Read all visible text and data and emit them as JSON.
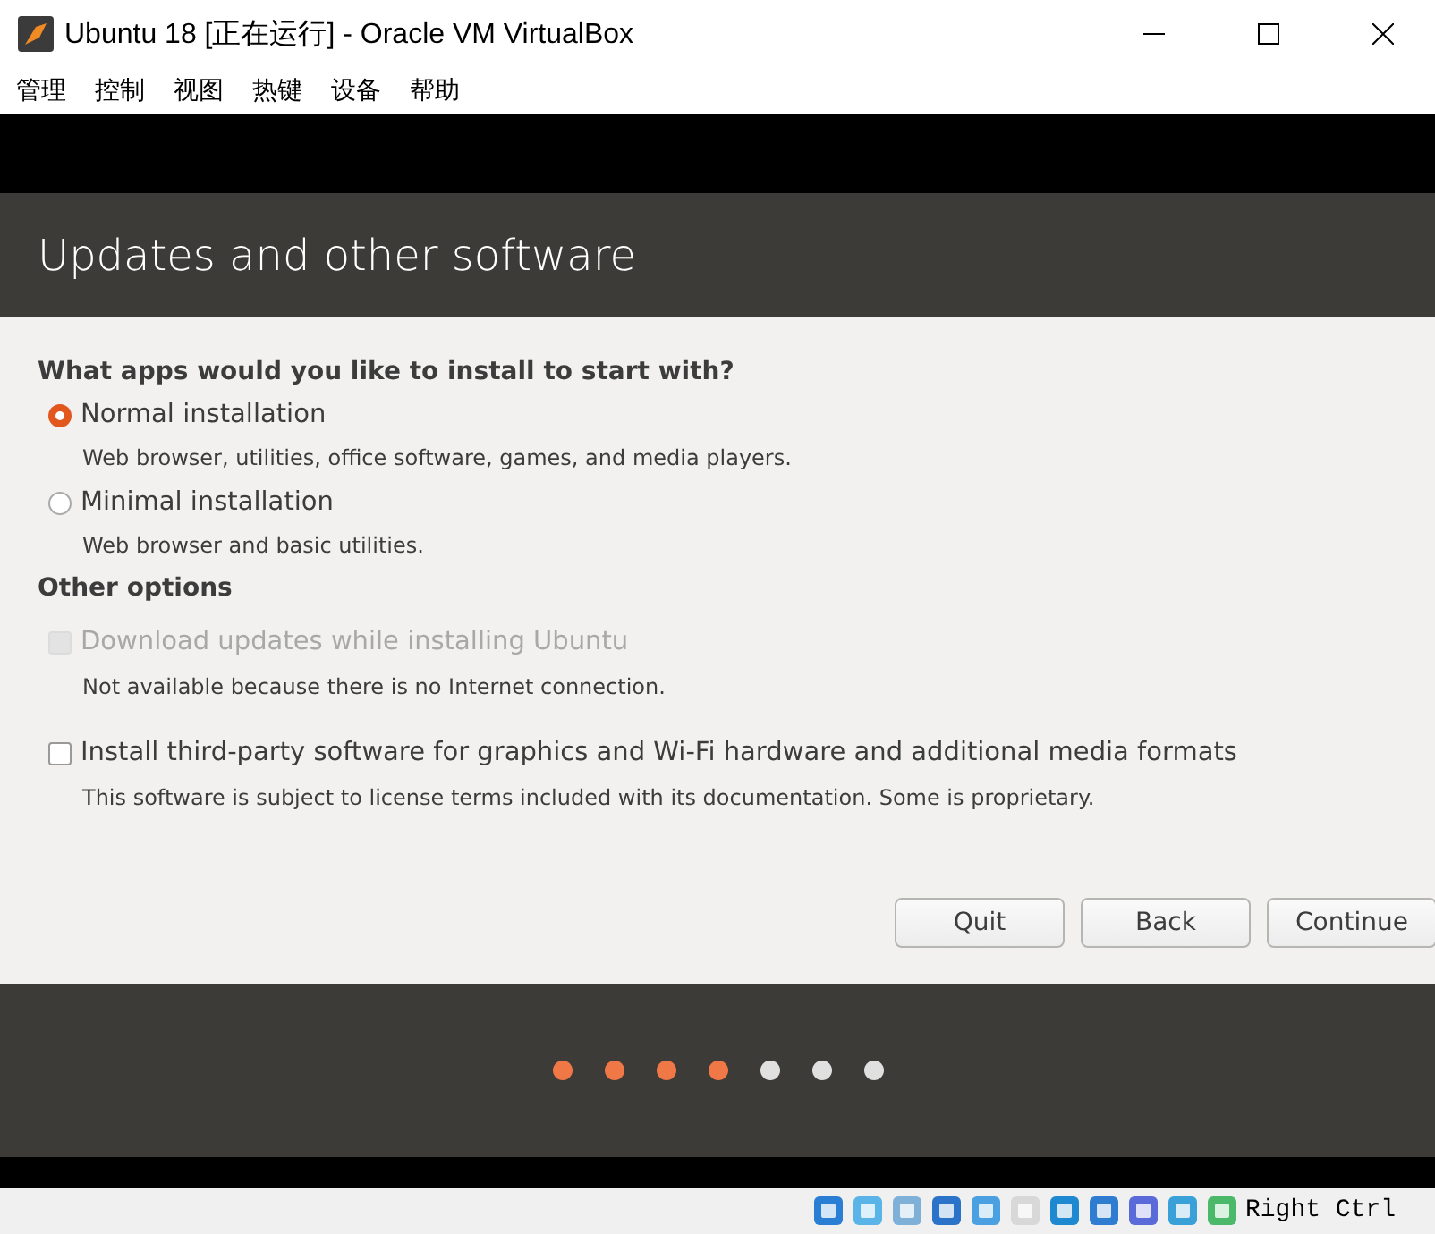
{
  "window": {
    "title": "Ubuntu 18 [正在运行] - Oracle VM VirtualBox"
  },
  "menu": [
    "管理",
    "控制",
    "视图",
    "热键",
    "设备",
    "帮助"
  ],
  "header": {
    "title": "Updates and other software"
  },
  "question": "What apps would you like to install to start with?",
  "install_types": [
    {
      "label": "Normal installation",
      "description": "Web browser, utilities, office software, games, and media players.",
      "selected": true
    },
    {
      "label": "Minimal installation",
      "description": "Web browser and basic utilities.",
      "selected": false
    }
  ],
  "other_heading": "Other options",
  "options": [
    {
      "label": "Download updates while installing Ubuntu",
      "description": "Not available because there is no Internet connection.",
      "checked": false,
      "disabled": true
    },
    {
      "label": "Install third-party software for graphics and Wi-Fi hardware and additional media formats",
      "description": "This software is subject to license terms included with its documentation. Some is proprietary.",
      "checked": false,
      "disabled": false
    }
  ],
  "buttons": [
    "Quit",
    "Back",
    "Continue"
  ],
  "steps": [
    {
      "done": true
    },
    {
      "done": true
    },
    {
      "done": true
    },
    {
      "done": true
    },
    {
      "done": false
    },
    {
      "done": false
    },
    {
      "done": false
    }
  ],
  "status_bar": {
    "host_key": "Right Ctrl"
  }
}
